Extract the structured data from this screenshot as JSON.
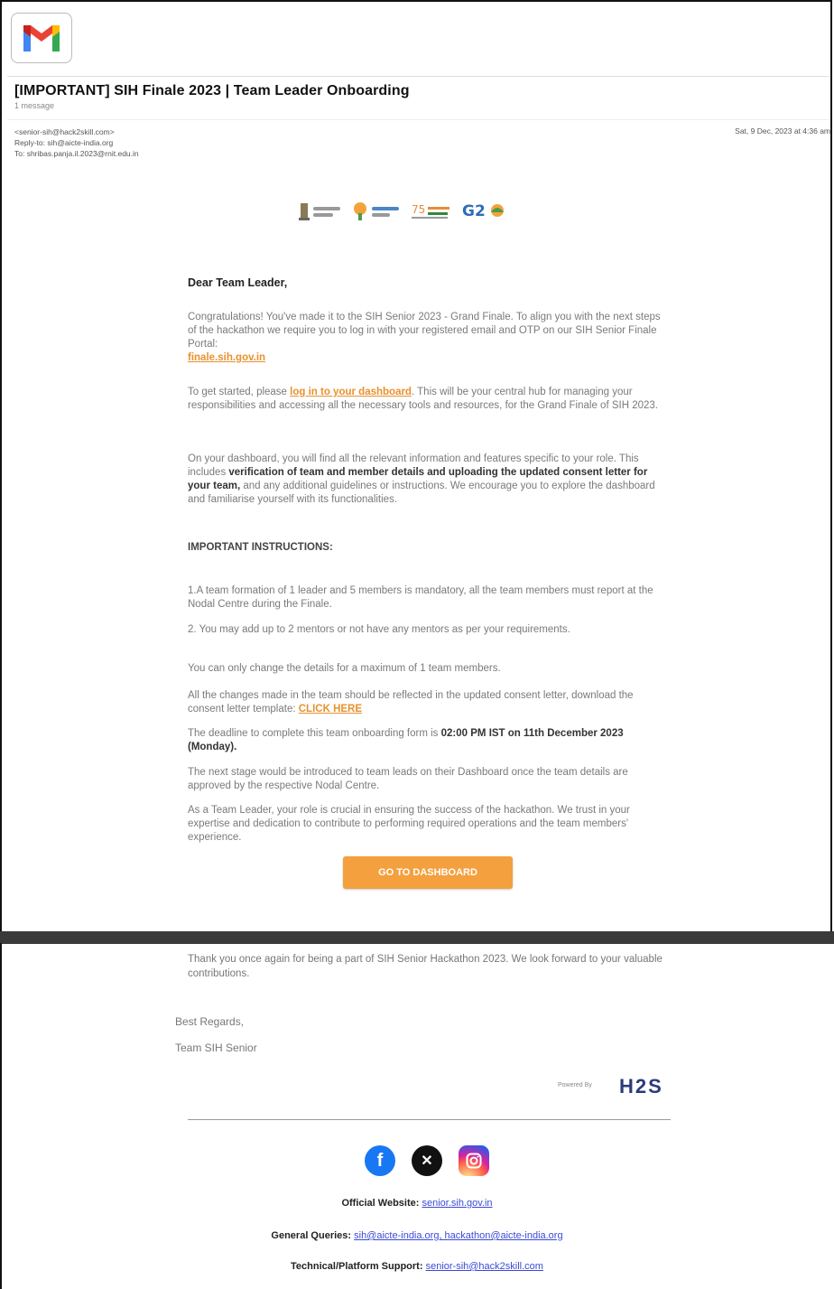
{
  "header": {
    "subject": "[IMPORTANT] SIH Finale 2023 | Team Leader Onboarding",
    "message_count": "1 message",
    "from": "<senior-sih@hack2skill.com>",
    "reply_to": "Reply-to: sih@aicte-india.org",
    "to": "To: shribas.panja.il.2023@rnit.edu.in",
    "date": "Sat, 9 Dec, 2023 at 4:36 am"
  },
  "body": {
    "greeting": "Dear Team Leader,",
    "para1": "Congratulations! You've made it to the SIH Senior 2023 - Grand Finale. To align you with the next steps of the hackathon we require you to log in with your registered email and OTP on our SIH Senior Finale Portal:",
    "portal_link": "finale.sih.gov.in",
    "para2_start": "To get started, please ",
    "para2_link": "log in to your dashboard",
    "para2_end": ". This will be your central hub for managing your responsibilities and accessing all the necessary tools and resources, for the Grand Finale of SIH 2023.",
    "para3_start": "On your dashboard, you will find all the relevant information and features specific to your role. This includes ",
    "para3_bold": "verification of team and member details and uploading the updated consent letter for your team,",
    "para3_end": " and any additional guidelines or instructions. We encourage you to explore the dashboard and familiarise yourself with its functionalities.",
    "instructions_title": "IMPORTANT INSTRUCTIONS:",
    "i1": "1.A team formation of 1 leader and 5 members is mandatory, all the team members must report at the Nodal Centre during the Finale.",
    "i2": "2. You may add up to 2 mentors or not have any mentors as per your requirements.",
    "i3": "You can only change the details for a maximum of 1 team members.",
    "i4_start": "All the changes made in the team should be reflected in the updated consent letter, download the consent letter template: ",
    "i4_link": "CLICK HERE",
    "i5_start": "The deadline to complete this team onboarding form is ",
    "i5_bold": "02:00 PM IST on 11th December 2023 (Monday).",
    "i6": "The next stage would be introduced to team leads on their Dashboard once the team details are approved by the respective Nodal Centre.",
    "i7": "As a Team Leader, your role is crucial in ensuring the success of the hackathon. We trust in your expertise and dedication to contribute to performing required operations and the team members' experience.",
    "cta": "GO TO DASHBOARD"
  },
  "footer": {
    "thanks": "Thank you once again for being a part of SIH Senior Hackathon 2023. We look forward to your valuable contributions.",
    "regards": "Best Regards,",
    "team": "Team SIH Senior",
    "powered_by": "Powered By",
    "brand": "H2S",
    "website_label": "Official Website:",
    "website": "senior.sih.gov.in",
    "queries_label": "General Queries:",
    "queries": "sih@aicte-india.org, hackathon@aicte-india.org",
    "support_label": "Technical/Platform Support:",
    "support": "senior-sih@hack2skill.com"
  },
  "icons": [
    "gmail-logo-icon",
    "facebook-icon",
    "x-icon",
    "instagram-icon"
  ]
}
